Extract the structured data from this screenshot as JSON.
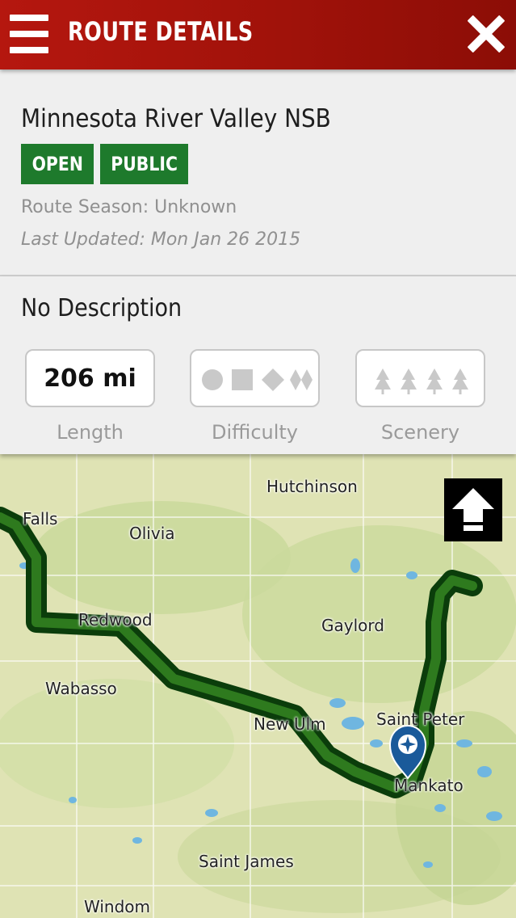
{
  "header": {
    "title": "ROUTE DETAILS",
    "colors": {
      "bar": "#a8140c",
      "accent": "#1e7a2c"
    }
  },
  "route": {
    "name": "Minnesota River Valley NSB",
    "badges": [
      "OPEN",
      "PUBLIC"
    ],
    "season": "Route Season: Unknown",
    "last_updated": "Last Updated: Mon Jan 26 2015",
    "description": "No Description"
  },
  "stats": {
    "length": {
      "value": "206 mi",
      "label": "Length"
    },
    "difficulty": {
      "icons": [
        "circle-icon",
        "square-icon",
        "diamond-icon",
        "double-diamond-icon"
      ],
      "label": "Difficulty"
    },
    "scenery": {
      "icons": [
        "tree-icon",
        "tree-icon",
        "tree-icon",
        "tree-icon"
      ],
      "label": "Scenery"
    }
  },
  "map": {
    "towns": [
      "Hutchinson",
      "Falls",
      "Olivia",
      "Redwood",
      "Gaylord",
      "Wabasso",
      "Saint Peter",
      "New Ulm",
      "Mankato",
      "Saint James",
      "Windom"
    ],
    "marker_icon": "compass-pin-icon",
    "scroll_button_icon": "arrow-up-icon"
  }
}
